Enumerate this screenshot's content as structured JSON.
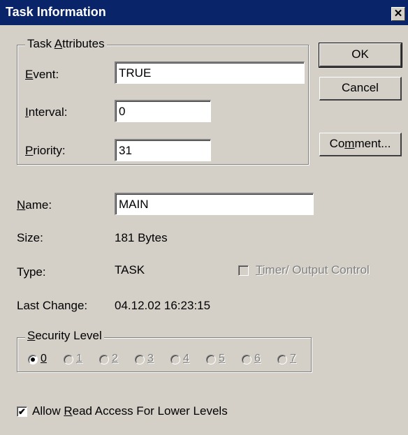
{
  "window": {
    "title": "Task Information",
    "close_glyph": "✕"
  },
  "task_attributes": {
    "legend_pre": "Task ",
    "legend_ul": "A",
    "legend_post": "ttributes",
    "event": {
      "label_ul": "E",
      "label_rest": "vent:",
      "value": "TRUE"
    },
    "interval": {
      "label_ul": "I",
      "label_rest": "nterval:",
      "value": "0"
    },
    "priority": {
      "label_ul": "P",
      "label_rest": "riority:",
      "value": "31"
    }
  },
  "buttons": {
    "ok": "OK",
    "cancel": "Cancel",
    "comment_pre": "Co",
    "comment_ul": "m",
    "comment_post": "ment..."
  },
  "name": {
    "label_ul": "N",
    "label_rest": "ame:",
    "value": "MAIN"
  },
  "size": {
    "label": "Size:",
    "value": "181 Bytes"
  },
  "type": {
    "label": "Type:",
    "value": "TASK"
  },
  "timer_control": {
    "label_ul": "T",
    "label_rest": "imer/ Output Control",
    "checked": false
  },
  "last_change": {
    "label": "Last Change:",
    "value": "04.12.02 16:23:15"
  },
  "security_level": {
    "legend_ul": "S",
    "legend_rest": "ecurity Level",
    "levels": [
      "0",
      "1",
      "2",
      "3",
      "4",
      "5",
      "6",
      "7"
    ],
    "selected": "0"
  },
  "allow_read": {
    "label_pre": "Allow ",
    "label_ul": "R",
    "label_post": "ead Access For Lower Levels",
    "checked": true,
    "check_glyph": "✔"
  }
}
